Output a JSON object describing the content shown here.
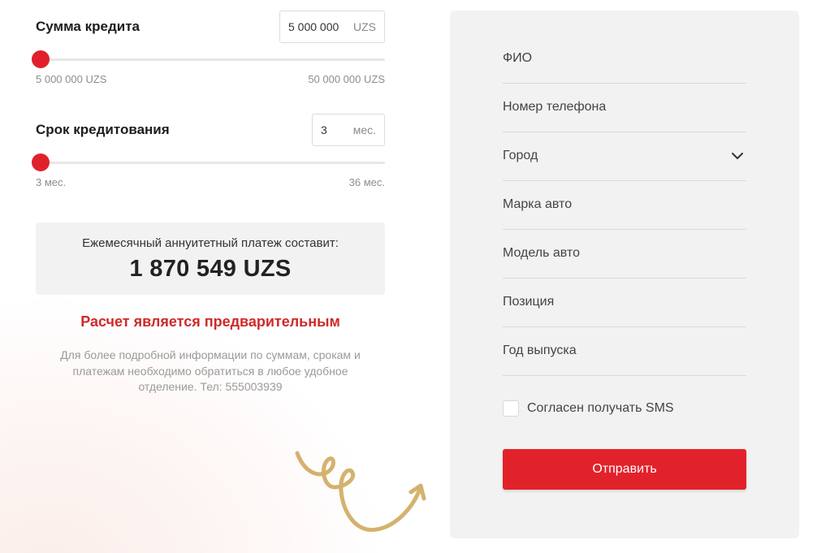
{
  "calculator": {
    "amount": {
      "label": "Сумма кредита",
      "value": "5 000 000",
      "unit": "UZS",
      "min_label": "5 000 000 UZS",
      "max_label": "50 000 000 UZS",
      "position": 0
    },
    "term": {
      "label": "Срок кредитования",
      "value": "3",
      "unit": "мес.",
      "min_label": "3 мес.",
      "max_label": "36 мес.",
      "position": 0
    },
    "result": {
      "label": "Ежемесячный аннуитетный платеж составит:",
      "value": "1 870 549 UZS"
    },
    "warning": "Расчет является предварительным",
    "note": "Для более подробной информации по суммам, срокам и платежам необходимо обратиться в любое удобное отделение. Тел: 555003939"
  },
  "form": {
    "fields": [
      {
        "label": "ФИО"
      },
      {
        "label": "Номер телефона"
      },
      {
        "label": "Город",
        "dropdown": true
      },
      {
        "label": "Марка авто"
      },
      {
        "label": "Модель авто"
      },
      {
        "label": "Позиция"
      },
      {
        "label": "Год выпуска"
      }
    ],
    "consent_label": "Согласен получать SMS",
    "consent_checked": false,
    "submit_label": "Отправить"
  },
  "colors": {
    "accent": "#e2222b",
    "warning_text": "#cf2a2a",
    "decoration": "#d4b26e",
    "panel": "#f2f2f2"
  },
  "icons": {
    "dropdown": "chevron-down-icon",
    "decoration": "swirl-arrow-icon"
  }
}
